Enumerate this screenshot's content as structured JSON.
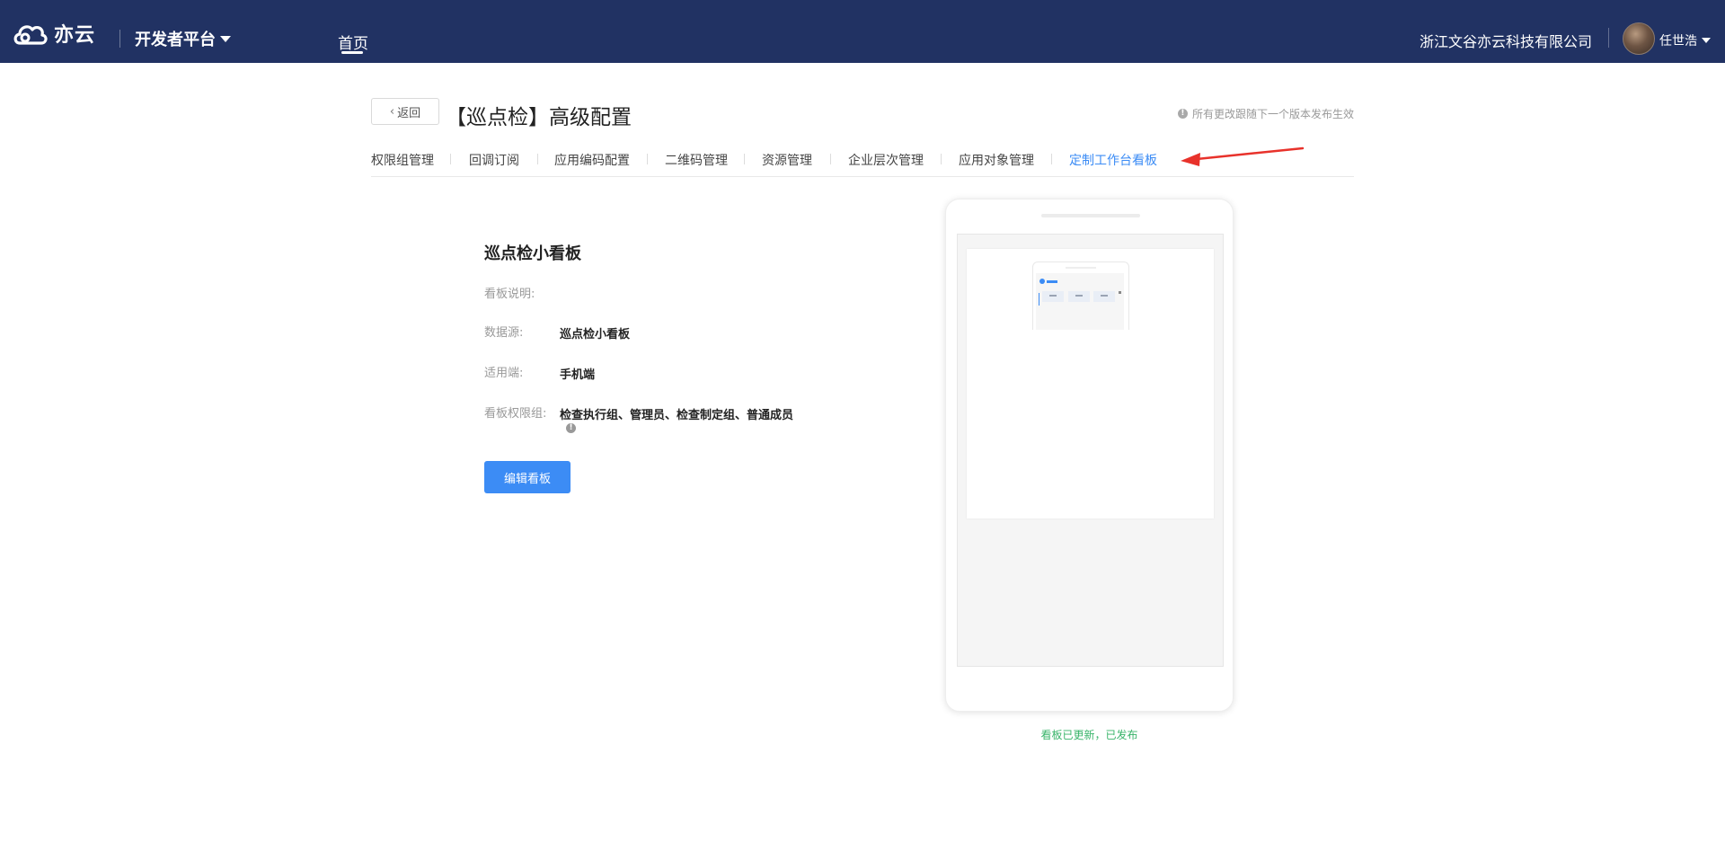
{
  "header": {
    "logo_text": "亦云",
    "platform_label": "开发者平台",
    "nav_home": "首页",
    "company_name": "浙江文谷亦云科技有限公司",
    "user_name": "任世浩"
  },
  "page": {
    "back_label": "返回",
    "title": "【巡点检】高级配置",
    "notice": "所有更改跟随下一个版本发布生效"
  },
  "tabs": [
    {
      "label": "权限组管理",
      "active": false
    },
    {
      "label": "回调订阅",
      "active": false
    },
    {
      "label": "应用编码配置",
      "active": false
    },
    {
      "label": "二维码管理",
      "active": false
    },
    {
      "label": "资源管理",
      "active": false
    },
    {
      "label": "企业层次管理",
      "active": false
    },
    {
      "label": "应用对象管理",
      "active": false
    },
    {
      "label": "定制工作台看板",
      "active": true
    }
  ],
  "board": {
    "title": "巡点检小看板",
    "fields": {
      "description_label": "看板说明:",
      "description_value": "",
      "source_label": "数据源:",
      "source_value": "巡点检小看板",
      "platform_label": "适用端:",
      "platform_value": "手机端",
      "permission_label": "看板权限组:",
      "permission_value": "检查执行组、管理员、检查制定组、普通成员"
    },
    "edit_button": "编辑看板"
  },
  "preview": {
    "status": "看板已更新，已发布"
  },
  "colors": {
    "topbar": "#213263",
    "accent": "#3c8cf5",
    "success": "#39b46a",
    "annotation_arrow": "#e8322b"
  },
  "icons": {
    "logo": "cloud-logo-icon",
    "info": "info-icon",
    "back": "chevron-left-icon",
    "dropdown": "caret-down-icon"
  }
}
